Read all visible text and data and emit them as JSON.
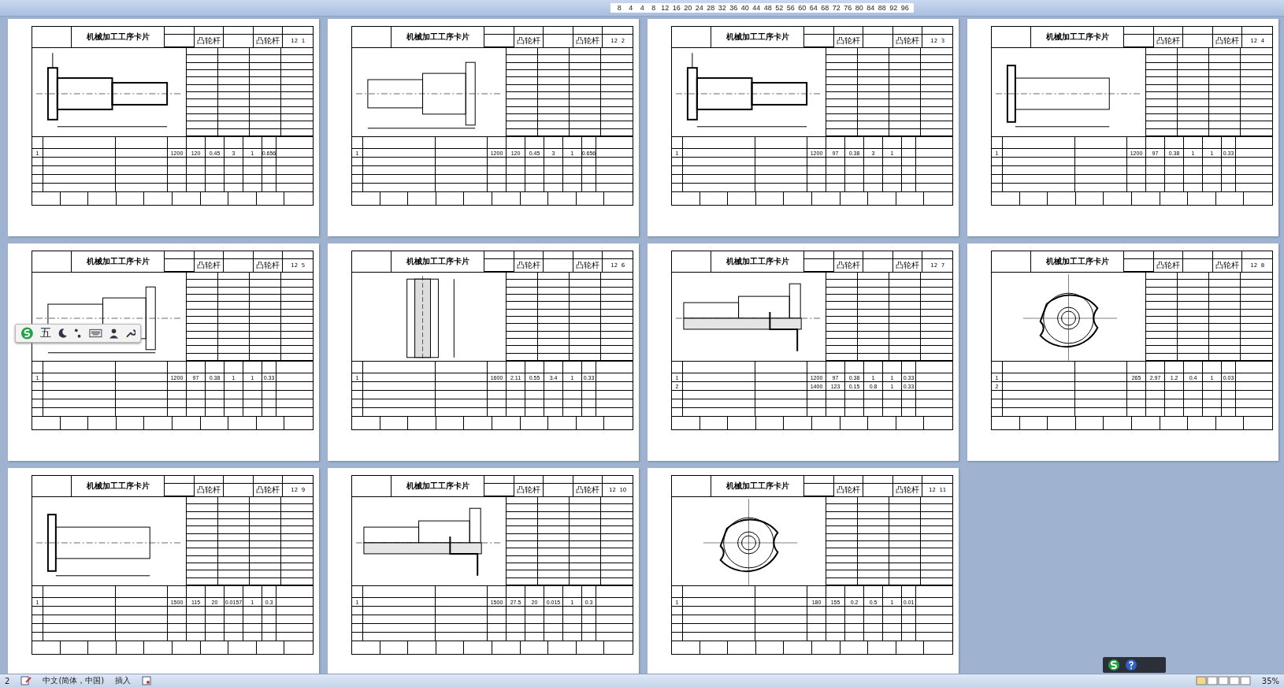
{
  "ruler": {
    "marks": [
      "8",
      "4",
      "4",
      "8",
      "12",
      "16",
      "20",
      "24",
      "28",
      "32",
      "36",
      "40",
      "44",
      "48",
      "52",
      "56",
      "60",
      "64",
      "68",
      "72",
      "76",
      "80",
      "84",
      "88",
      "92",
      "96"
    ]
  },
  "pages": [
    {
      "title": "机械加工工序卡片",
      "product_name": "凸轮杆",
      "part_name": "凸轮杆",
      "total_pages": "12",
      "page_no": "1",
      "kind": "stepped-shaft",
      "rows": [
        {
          "step": "1",
          "values": [
            "1200",
            "120",
            "0.45",
            "3",
            "1"
          ],
          "time": "0.656"
        }
      ]
    },
    {
      "title": "机械加工工序卡片",
      "product_name": "凸轮杆",
      "part_name": "凸轮杆",
      "total_pages": "12",
      "page_no": "2",
      "kind": "plain-shaft",
      "rows": [
        {
          "step": "1",
          "values": [
            "1200",
            "120",
            "0.45",
            "3",
            "1"
          ],
          "time": "0.656"
        }
      ]
    },
    {
      "title": "机械加工工序卡片",
      "product_name": "凸轮杆",
      "part_name": "凸轮杆",
      "total_pages": "12",
      "page_no": "3",
      "kind": "stepped-shaft",
      "rows": [
        {
          "step": "1",
          "values": [
            "1200",
            "97",
            "0.38",
            "3",
            "1"
          ]
        }
      ]
    },
    {
      "title": "机械加工工序卡片",
      "product_name": "凸轮杆",
      "part_name": "凸轮杆",
      "total_pages": "12",
      "page_no": "4",
      "kind": "flange-shaft",
      "rows": [
        {
          "step": "1",
          "values": [
            "1200",
            "97",
            "0.38",
            "1",
            "1"
          ],
          "time": "0.33"
        }
      ]
    },
    {
      "title": "机械加工工序卡片",
      "product_name": "凸轮杆",
      "part_name": "凸轮杆",
      "total_pages": "12",
      "page_no": "5",
      "kind": "plain-shaft",
      "rows": [
        {
          "step": "1",
          "values": [
            "1200",
            "97",
            "0.38",
            "1",
            "1"
          ],
          "time": "0.33"
        }
      ]
    },
    {
      "title": "机械加工工序卡片",
      "product_name": "凸轮杆",
      "part_name": "凸轮杆",
      "total_pages": "12",
      "page_no": "6",
      "kind": "bore-section",
      "rows": [
        {
          "step": "1",
          "values": [
            "1600",
            "2.11",
            "0.55",
            "3.4",
            "1"
          ],
          "time": "0.33"
        }
      ]
    },
    {
      "title": "机械加工工序卡片",
      "product_name": "凸轮杆",
      "part_name": "凸轮杆",
      "total_pages": "12",
      "page_no": "7",
      "kind": "section-shaft",
      "rows": [
        {
          "step": "1",
          "values": [
            "1200",
            "97",
            "0.38",
            "1",
            "1"
          ],
          "time": "0.33"
        },
        {
          "step": "2",
          "values": [
            "1400",
            "123",
            "0.15",
            "0.8",
            "1"
          ],
          "time": "0.33"
        }
      ]
    },
    {
      "title": "机械加工工序卡片",
      "product_name": "凸轮杆",
      "part_name": "凸轮杆",
      "total_pages": "12",
      "page_no": "8",
      "kind": "cam-disc",
      "rows": [
        {
          "step": "1",
          "values": [
            "265",
            "2.97",
            "1.2",
            "0.4",
            "1"
          ],
          "time": "0.03"
        },
        {
          "step": "2"
        }
      ]
    },
    {
      "title": "机械加工工序卡片",
      "product_name": "凸轮杆",
      "part_name": "凸轮杆",
      "total_pages": "12",
      "page_no": "9",
      "kind": "flange-shaft",
      "rows": [
        {
          "step": "1",
          "values": [
            "1500",
            "115",
            "20",
            "0.0157",
            "1"
          ],
          "time": "0.3"
        }
      ]
    },
    {
      "title": "机械加工工序卡片",
      "product_name": "凸轮杆",
      "part_name": "凸轮杆",
      "total_pages": "12",
      "page_no": "10",
      "kind": "section-shaft",
      "rows": [
        {
          "step": "1",
          "values": [
            "1500",
            "27.5",
            "20",
            "0.015",
            "1"
          ],
          "time": "0.3"
        }
      ]
    },
    {
      "title": "机械加工工序卡片",
      "product_name": "凸轮杆",
      "part_name": "凸轮杆",
      "total_pages": "12",
      "page_no": "11",
      "kind": "cam-disc",
      "rows": [
        {
          "step": "1",
          "values": [
            "180",
            "155",
            "0.2",
            "0.5",
            "1"
          ],
          "time": "0.01"
        }
      ]
    }
  ],
  "ime_toolbar": {
    "label": "五"
  },
  "status_bar": {
    "page": "2",
    "language": "中文(简体，中国)",
    "mode": "插入",
    "zoom": "35%"
  }
}
